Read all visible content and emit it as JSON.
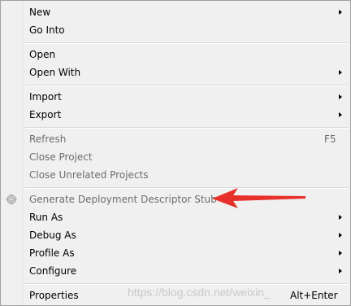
{
  "menu": {
    "items": [
      {
        "label": "New"
      },
      {
        "label": "Go Into"
      },
      {
        "label": "Open"
      },
      {
        "label": "Open With"
      },
      {
        "label": "Import"
      },
      {
        "label": "Export"
      },
      {
        "label": "Refresh",
        "shortcut": "F5"
      },
      {
        "label": "Close Project"
      },
      {
        "label": "Close Unrelated Projects"
      },
      {
        "label": "Generate Deployment Descriptor Stub"
      },
      {
        "label": "Run As"
      },
      {
        "label": "Debug As"
      },
      {
        "label": "Profile As"
      },
      {
        "label": "Configure"
      },
      {
        "label": "Properties",
        "shortcut": "Alt+Enter"
      }
    ]
  },
  "watermark": "https://blog.csdn.net/weixin_",
  "colors": {
    "annotation_arrow": "#e8302a",
    "disabled_text": "#6d6d6d"
  },
  "icons": {
    "generate_descriptor": "gear-icon",
    "submenu": "chevron-right-icon"
  }
}
